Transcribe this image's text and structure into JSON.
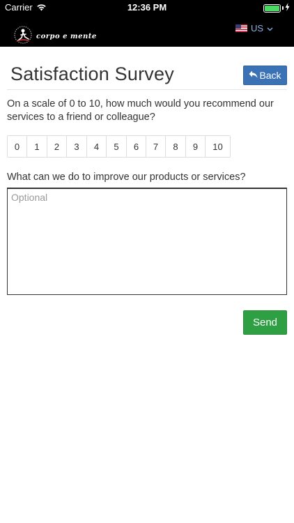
{
  "status_bar": {
    "carrier": "Carrier",
    "time": "12:36 PM",
    "battery_level": 1.0,
    "wifi_icon": "wifi-icon",
    "battery_icon": "battery-icon",
    "charging_icon": "bolt-icon"
  },
  "header": {
    "logo_text": "corpo e mente",
    "language": {
      "label": "US",
      "flag_icon": "us-flag-icon",
      "chevron_icon": "chevron-down-icon"
    }
  },
  "page": {
    "title": "Satisfaction Survey",
    "back_label": "Back",
    "back_icon": "reply-arrow-icon"
  },
  "survey": {
    "question_1": "On a scale of 0 to 10, how much would you recommend our services to a friend or colleague?",
    "scale": [
      "0",
      "1",
      "2",
      "3",
      "4",
      "5",
      "6",
      "7",
      "8",
      "9",
      "10"
    ],
    "question_2": "What can we do to improve our products or services?",
    "feedback_placeholder": "Optional",
    "feedback_value": "",
    "send_label": "Send"
  },
  "colors": {
    "header_bg": "#000000",
    "back_button": "#3a72b5",
    "send_button": "#2ea043",
    "language_link": "#8db3e8",
    "battery": "#4cd964"
  }
}
